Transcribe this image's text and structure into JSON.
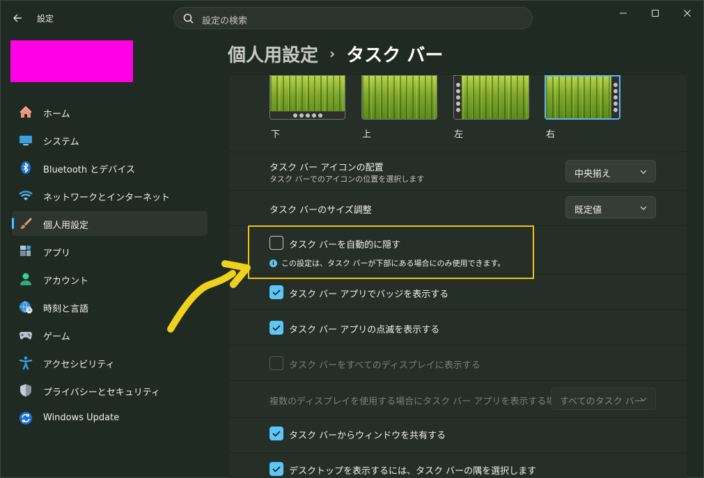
{
  "window": {
    "title": "設定",
    "search_placeholder": "設定の検索"
  },
  "sidebar": {
    "items": [
      {
        "label": "ホーム",
        "icon": "home-icon",
        "active": false
      },
      {
        "label": "システム",
        "icon": "monitor-icon",
        "active": false
      },
      {
        "label": "Bluetooth とデバイス",
        "icon": "bluetooth-icon",
        "active": false
      },
      {
        "label": "ネットワークとインターネット",
        "icon": "wifi-icon",
        "active": false
      },
      {
        "label": "個人用設定",
        "icon": "paintbrush-icon",
        "active": true
      },
      {
        "label": "アプリ",
        "icon": "apps-icon",
        "active": false
      },
      {
        "label": "アカウント",
        "icon": "person-icon",
        "active": false
      },
      {
        "label": "時刻と言語",
        "icon": "globe-clock-icon",
        "active": false
      },
      {
        "label": "ゲーム",
        "icon": "gamepad-icon",
        "active": false
      },
      {
        "label": "アクセシビリティ",
        "icon": "accessibility-icon",
        "active": false
      },
      {
        "label": "プライバシーとセキュリティ",
        "icon": "shield-icon",
        "active": false
      },
      {
        "label": "Windows Update",
        "icon": "update-icon",
        "active": false
      }
    ]
  },
  "header": {
    "parent": "個人用設定",
    "separator": "›",
    "current": "タスク バー"
  },
  "position": {
    "options": [
      {
        "label": "下",
        "bar": "bottom",
        "selected": false
      },
      {
        "label": "上",
        "bar": "none",
        "selected": false
      },
      {
        "label": "左",
        "bar": "left",
        "selected": false
      },
      {
        "label": "右",
        "bar": "right",
        "selected": true
      }
    ]
  },
  "settings": {
    "alignment": {
      "title": "タスク バー アイコンの配置",
      "subtitle": "タスク バーでのアイコンの位置を選択します",
      "value": "中央揃え"
    },
    "size": {
      "title": "タスク バーのサイズ調整",
      "value": "既定値"
    },
    "autohide": {
      "label": "タスク バーを自動的に隠す",
      "checked": false,
      "info": "この設定は、タスク バーが下部にある場合にのみ使用できます。"
    },
    "badges": {
      "label": "タスク バー アプリでバッジを表示する",
      "checked": true
    },
    "flashing": {
      "label": "タスク バー アプリの点滅を表示する",
      "checked": true
    },
    "all_displays": {
      "label": "タスク バーをすべてのディスプレイに表示する",
      "checked": false,
      "disabled": true
    },
    "multi_display": {
      "title": "複数のディスプレイを使用する場合にタスク バー アプリを表示する場所",
      "value": "すべてのタスク バー",
      "disabled": true
    },
    "share_window": {
      "label": "タスク バーからウィンドウを共有する",
      "checked": true
    },
    "far_corner": {
      "label": "デスクトップを表示するには、タスク バーの隅を選択します",
      "checked": true
    }
  },
  "colors": {
    "accent": "#5cc6f7",
    "highlight": "#f0c419",
    "profile_block": "#ff00e6"
  }
}
